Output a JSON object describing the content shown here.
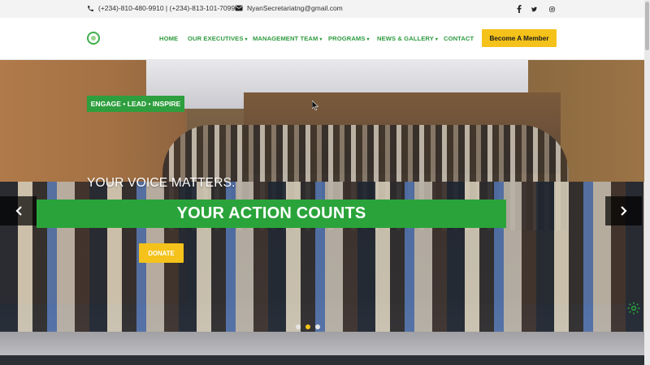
{
  "topbar": {
    "phone_text": "(+234)-810-480-9910 | (+234)-813-101-7099",
    "email_text": "NyanSecretariatng@gmail.com",
    "social_icons": [
      "facebook-icon",
      "twitter-icon",
      "instagram-icon"
    ]
  },
  "nav": {
    "items": [
      {
        "label": "HOME",
        "has_caret": false
      },
      {
        "label": "OUR EXECUTIVES",
        "has_caret": true
      },
      {
        "label": "MANAGEMENT TEAM",
        "has_caret": true
      },
      {
        "label": "PROGRAMS",
        "has_caret": true
      },
      {
        "label": "NEWS & GALLERY",
        "has_caret": true
      },
      {
        "label": "CONTACT",
        "has_caret": false
      }
    ],
    "caret": "▾",
    "cta_label": "Become A Member"
  },
  "hero": {
    "tag": "ENGAGE • LEAD • INSPIRE",
    "line1": "YOUR VOICE MATTERS.",
    "line2": "YOUR ACTION COUNTS",
    "donate_label": "DONATE",
    "slide_count": 3,
    "active_slide": 2
  },
  "colors": {
    "brand_green": "#2aa43a",
    "nav_green": "#2f9b40",
    "accent_yellow": "#f4c21a"
  }
}
